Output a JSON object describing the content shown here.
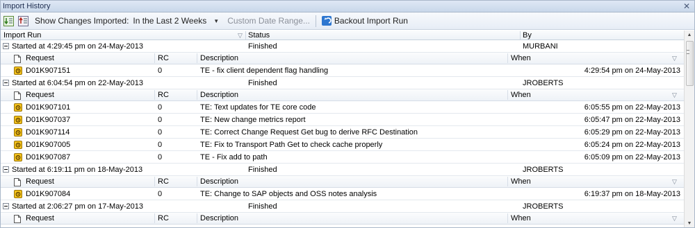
{
  "window": {
    "title": "Import History"
  },
  "toolbar": {
    "show_label": "Show Changes Imported:",
    "period_value": "In the Last 2 Weeks",
    "date_range_label": "Custom Date Range...",
    "backout_label": "Backout Import Run"
  },
  "columns": {
    "import_run": "Import Run",
    "status": "Status",
    "by": "By"
  },
  "subcolumns": {
    "request": "Request",
    "rc": "RC",
    "description": "Description",
    "when": "When"
  },
  "runs": [
    {
      "label": "Started at 4:29:45 pm on 24-May-2013",
      "status": "Finished",
      "by": "MURBANI",
      "requests": [
        {
          "id": "D01K907151",
          "rc": "0",
          "description": "TE - fix client dependent flag handling",
          "when": "4:29:54 pm on 24-May-2013"
        }
      ]
    },
    {
      "label": "Started at 6:04:54 pm on 22-May-2013",
      "status": "Finished",
      "by": "JROBERTS",
      "requests": [
        {
          "id": "D01K907101",
          "rc": "0",
          "description": "TE: Text updates for TE core code",
          "when": "6:05:55 pm on 22-May-2013"
        },
        {
          "id": "D01K907037",
          "rc": "0",
          "description": "TE: New change metrics report",
          "when": "6:05:47 pm on 22-May-2013"
        },
        {
          "id": "D01K907114",
          "rc": "0",
          "description": "TE: Correct Change Request Get bug to derive RFC Destination",
          "when": "6:05:29 pm on 22-May-2013"
        },
        {
          "id": "D01K907005",
          "rc": "0",
          "description": "TE: Fix to Transport Path Get to check cache properly",
          "when": "6:05:24 pm on 22-May-2013"
        },
        {
          "id": "D01K907087",
          "rc": "0",
          "description": "TE - Fix add to path",
          "when": "6:05:09 pm on 22-May-2013"
        }
      ]
    },
    {
      "label": "Started at 6:19:11 pm on 18-May-2013",
      "status": "Finished",
      "by": "JROBERTS",
      "requests": [
        {
          "id": "D01K907084",
          "rc": "0",
          "description": "TE: Change to SAP objects and OSS notes analysis",
          "when": "6:19:37 pm on 18-May-2013"
        }
      ]
    },
    {
      "label": "Started at 2:06:27 pm on 17-May-2013",
      "status": "Finished",
      "by": "JROBERTS",
      "requests": []
    }
  ]
}
